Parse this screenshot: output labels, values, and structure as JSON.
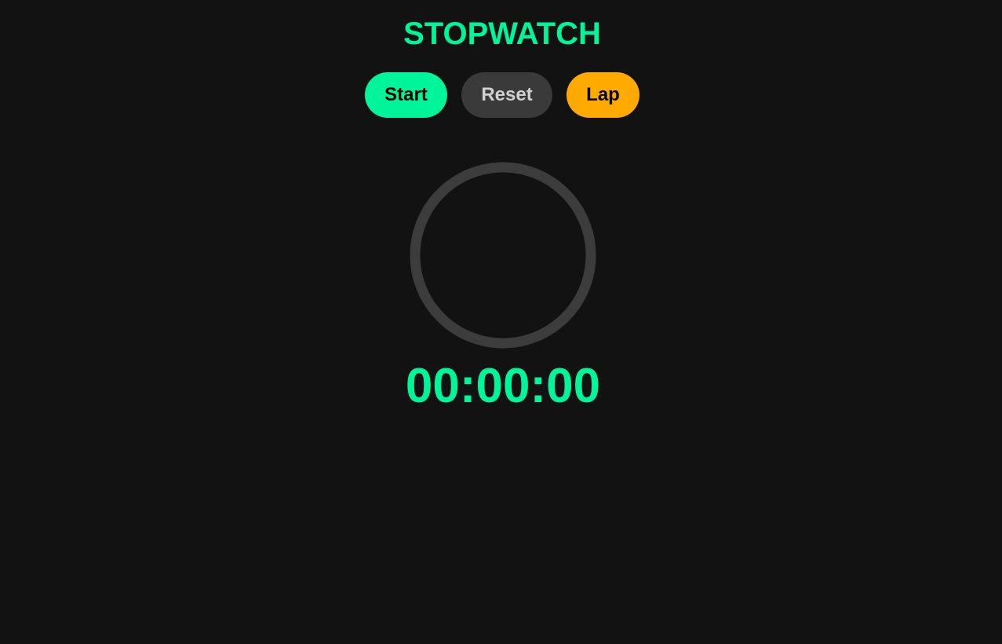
{
  "app": {
    "title": "STOPWATCH"
  },
  "controls": {
    "start_label": "Start",
    "reset_label": "Reset",
    "lap_label": "Lap"
  },
  "display": {
    "time": "00:00:00",
    "progress": 0
  },
  "colors": {
    "background": "#121212",
    "accent": "#00f59a",
    "reset": "#3a3a3a",
    "lap": "#ffaa00",
    "ring": "#3c3c3c"
  },
  "icons": {
    "dial": "progress-ring-icon"
  }
}
